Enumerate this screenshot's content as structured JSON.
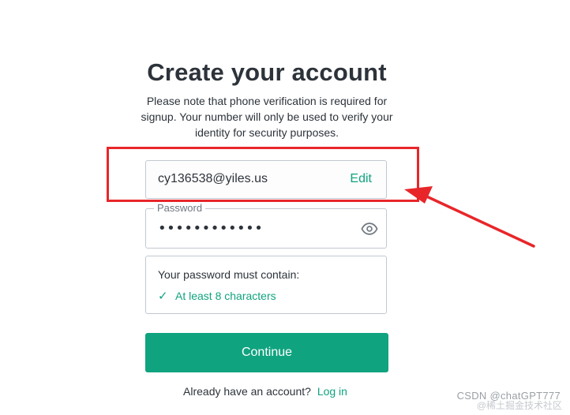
{
  "header": {
    "title": "Create your account",
    "subtitle": "Please note that phone verification is required for signup. Your number will only be used to verify your identity for security purposes."
  },
  "email": {
    "value": "cy136538@yiles.us",
    "edit_label": "Edit"
  },
  "password": {
    "label": "Password",
    "value": "••••••••••••",
    "toggle_icon": "eye-icon"
  },
  "requirements": {
    "heading": "Your password must contain:",
    "items": [
      {
        "check_icon": "✓",
        "label": "At least 8 characters"
      }
    ]
  },
  "actions": {
    "continue_label": "Continue"
  },
  "footer": {
    "prompt": "Already have an account?",
    "login_label": "Log in"
  },
  "annotation": {
    "highlight_color": "#e8262a"
  },
  "watermark": {
    "text": "CSDN @chatGPT777",
    "overlay_text": "@稀土掘金技术社区"
  },
  "colors": {
    "accent": "#10a37f",
    "text": "#2d333a",
    "border": "#c2c8d0"
  }
}
